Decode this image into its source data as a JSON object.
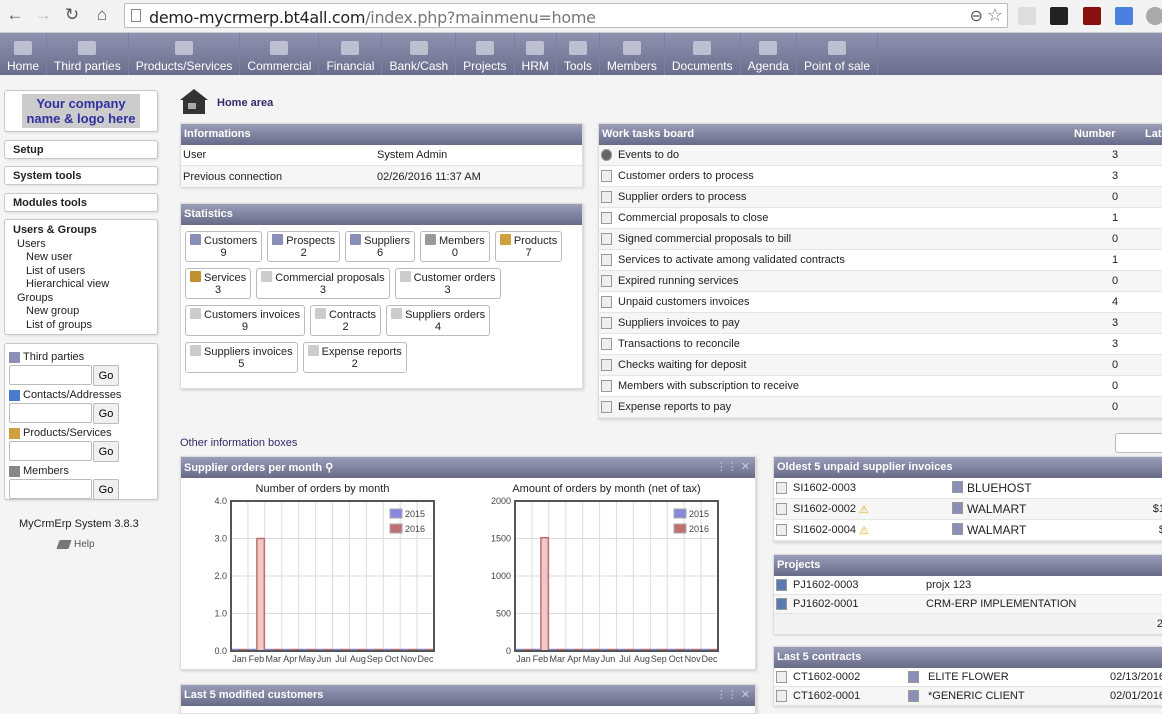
{
  "browser": {
    "url_host": "demo-mycrmerp.bt4all.com",
    "url_path": "/index.php?mainmenu=home"
  },
  "topmenu": [
    {
      "label": "Home",
      "icon": "home-icon"
    },
    {
      "label": "Third parties",
      "icon": "company-icon"
    },
    {
      "label": "Products/Services",
      "icon": "products-icon"
    },
    {
      "label": "Commercial",
      "icon": "commercial-icon"
    },
    {
      "label": "Financial",
      "icon": "financial-icon"
    },
    {
      "label": "Bank/Cash",
      "icon": "bank-icon"
    },
    {
      "label": "Projects",
      "icon": "projects-icon"
    },
    {
      "label": "HRM",
      "icon": "hrm-icon"
    },
    {
      "label": "Tools",
      "icon": "tools-icon"
    },
    {
      "label": "Members",
      "icon": "members-icon"
    },
    {
      "label": "Documents",
      "icon": "documents-icon"
    },
    {
      "label": "Agenda",
      "icon": "agenda-icon"
    },
    {
      "label": "Point of sale",
      "icon": "pos-icon"
    }
  ],
  "sidebar": {
    "logo_line1": "Your company",
    "logo_line2": "name & logo here",
    "setup": "Setup",
    "system_tools": "System tools",
    "modules_tools": "Modules tools",
    "users_groups": {
      "title": "Users & Groups",
      "users": "Users",
      "new_user": "New user",
      "list_users": "List of users",
      "hierarchical": "Hierarchical view",
      "groups": "Groups",
      "new_group": "New group",
      "list_groups": "List of groups"
    },
    "search": [
      {
        "label": "Third parties",
        "button": "Go",
        "value": ""
      },
      {
        "label": "Contacts/Addresses",
        "button": "Go",
        "value": ""
      },
      {
        "label": "Products/Services",
        "button": "Go",
        "value": ""
      },
      {
        "label": "Members",
        "button": "Go",
        "value": ""
      }
    ],
    "version": "MyCrmErp System 3.8.3",
    "help": "Help"
  },
  "home_area": "Home area",
  "informations": {
    "title": "Informations",
    "rows": [
      {
        "label": "User",
        "value": "System Admin"
      },
      {
        "label": "Previous connection",
        "value": "02/26/2016 11:37 AM"
      }
    ]
  },
  "statistics": {
    "title": "Statistics",
    "items": [
      {
        "label": "Customers",
        "value": "9"
      },
      {
        "label": "Prospects",
        "value": "2"
      },
      {
        "label": "Suppliers",
        "value": "6"
      },
      {
        "label": "Members",
        "value": "0"
      },
      {
        "label": "Products",
        "value": "7"
      },
      {
        "label": "Services",
        "value": "3"
      },
      {
        "label": "Commercial proposals",
        "value": "3"
      },
      {
        "label": "Customer orders",
        "value": "3"
      },
      {
        "label": "Customers invoices",
        "value": "9"
      },
      {
        "label": "Contracts",
        "value": "2"
      },
      {
        "label": "Suppliers orders",
        "value": "4"
      },
      {
        "label": "Suppliers invoices",
        "value": "5"
      },
      {
        "label": "Expense reports",
        "value": "2"
      }
    ]
  },
  "worktasks": {
    "title": "Work tasks board",
    "col_number": "Number",
    "col_late": "Lat",
    "rows": [
      {
        "label": "Events to do",
        "value": "3"
      },
      {
        "label": "Customer orders to process",
        "value": "3"
      },
      {
        "label": "Supplier orders to process",
        "value": "0"
      },
      {
        "label": "Commercial proposals to close",
        "value": "1"
      },
      {
        "label": "Signed commercial proposals to bill",
        "value": "0"
      },
      {
        "label": "Services to activate among validated contracts",
        "value": "1"
      },
      {
        "label": "Expired running services",
        "value": "0"
      },
      {
        "label": "Unpaid customers invoices",
        "value": "4"
      },
      {
        "label": "Suppliers invoices to pay",
        "value": "3"
      },
      {
        "label": "Transactions to reconcile",
        "value": "3"
      },
      {
        "label": "Checks waiting for deposit",
        "value": "0"
      },
      {
        "label": "Members with subscription to receive",
        "value": "0"
      },
      {
        "label": "Expense reports to pay",
        "value": "0"
      }
    ]
  },
  "other_boxes": "Other information boxes",
  "supplier_orders": {
    "title": "Supplier orders per month"
  },
  "unpaid_invoices": {
    "title": "Oldest 5 unpaid supplier invoices",
    "rows": [
      {
        "ref": "SI1602-0003",
        "company": "BLUEHOST",
        "warn": false,
        "amount": ""
      },
      {
        "ref": "SI1602-0002",
        "company": "WALMART",
        "warn": true,
        "amount": "$1"
      },
      {
        "ref": "SI1602-0004",
        "company": "WALMART",
        "warn": true,
        "amount": "$"
      }
    ]
  },
  "projects": {
    "title": "Projects",
    "rows": [
      {
        "ref": "PJ1602-0003",
        "name": "projx 123"
      },
      {
        "ref": "PJ1602-0001",
        "name": "CRM-ERP IMPLEMENTATION"
      }
    ],
    "total": "2"
  },
  "contracts": {
    "title": "Last 5 contracts",
    "rows": [
      {
        "ref": "CT1602-0002",
        "company": "ELITE FLOWER",
        "date": "02/13/2016"
      },
      {
        "ref": "CT1602-0001",
        "company": "*GENERIC CLIENT",
        "date": "02/01/2016"
      }
    ]
  },
  "modified_customers": {
    "title": "Last 5 modified customers"
  },
  "chart_data": [
    {
      "type": "bar",
      "title": "Number of orders by month",
      "categories": [
        "Jan",
        "Feb",
        "Mar",
        "Apr",
        "May",
        "Jun",
        "Jul",
        "Aug",
        "Sep",
        "Oct",
        "Nov",
        "Dec"
      ],
      "series": [
        {
          "name": "2015",
          "color": "#8888dd",
          "values": [
            0,
            0,
            0,
            0,
            0,
            0,
            0,
            0,
            0,
            0,
            0,
            0
          ]
        },
        {
          "name": "2016",
          "color": "#c07070",
          "values": [
            0,
            3,
            0,
            0,
            0,
            0,
            0,
            0,
            0,
            0,
            0,
            0
          ]
        }
      ],
      "yticks": [
        "0.0",
        "1.0",
        "2.0",
        "3.0",
        "4.0"
      ],
      "ylim": [
        0,
        4
      ],
      "legend": "top-right",
      "grid": true
    },
    {
      "type": "bar",
      "title": "Amount of orders by month (net of tax)",
      "categories": [
        "Jan",
        "Feb",
        "Mar",
        "Apr",
        "May",
        "Jun",
        "Jul",
        "Aug",
        "Sep",
        "Oct",
        "Nov",
        "Dec"
      ],
      "series": [
        {
          "name": "2015",
          "color": "#8888dd",
          "values": [
            0,
            0,
            0,
            0,
            0,
            0,
            0,
            0,
            0,
            0,
            0,
            0
          ]
        },
        {
          "name": "2016",
          "color": "#c07070",
          "values": [
            0,
            1510,
            0,
            0,
            0,
            0,
            0,
            0,
            0,
            0,
            0,
            0
          ]
        }
      ],
      "yticks": [
        "0",
        "500",
        "1000",
        "1500",
        "2000"
      ],
      "ylim": [
        0,
        2000
      ],
      "legend": "top-right",
      "grid": true
    }
  ]
}
